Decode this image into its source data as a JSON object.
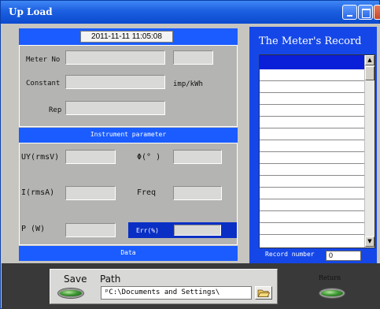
{
  "window": {
    "title": "Up Load"
  },
  "datetime": "2011-11-11 11:05:08",
  "meter": {
    "meter_no_label": "Meter No",
    "constant_label": "Constant",
    "constant_unit": "imp/kWh",
    "rep_label": "Rep",
    "meter_no_value": "",
    "meter_no_extra": "",
    "constant_value": "",
    "rep_value": ""
  },
  "instrument": {
    "header": "Instrument parameter",
    "uy_label": "UY(rmsV)",
    "phi_label": "Φ(° )",
    "i_label": "I(rmsA)",
    "freq_label": "Freq",
    "p_label": "P (W)",
    "err_label": "Err(%)",
    "uy_value": "",
    "phi_value": "",
    "i_value": "",
    "freq_value": "",
    "p_value": "",
    "err_value": ""
  },
  "data_bar": "Data",
  "record": {
    "title": "The Meter's Record",
    "record_number_label": "Record number",
    "record_number_value": "0"
  },
  "save": {
    "save_label": "Save",
    "path_label": "Path",
    "path_value": "C:\\Documents and Settings\\"
  },
  "return_label": "Return",
  "colors": {
    "accent_blue": "#1a5cff",
    "panel_gray": "#b4b4b2",
    "led_green": "#3f9a34"
  }
}
